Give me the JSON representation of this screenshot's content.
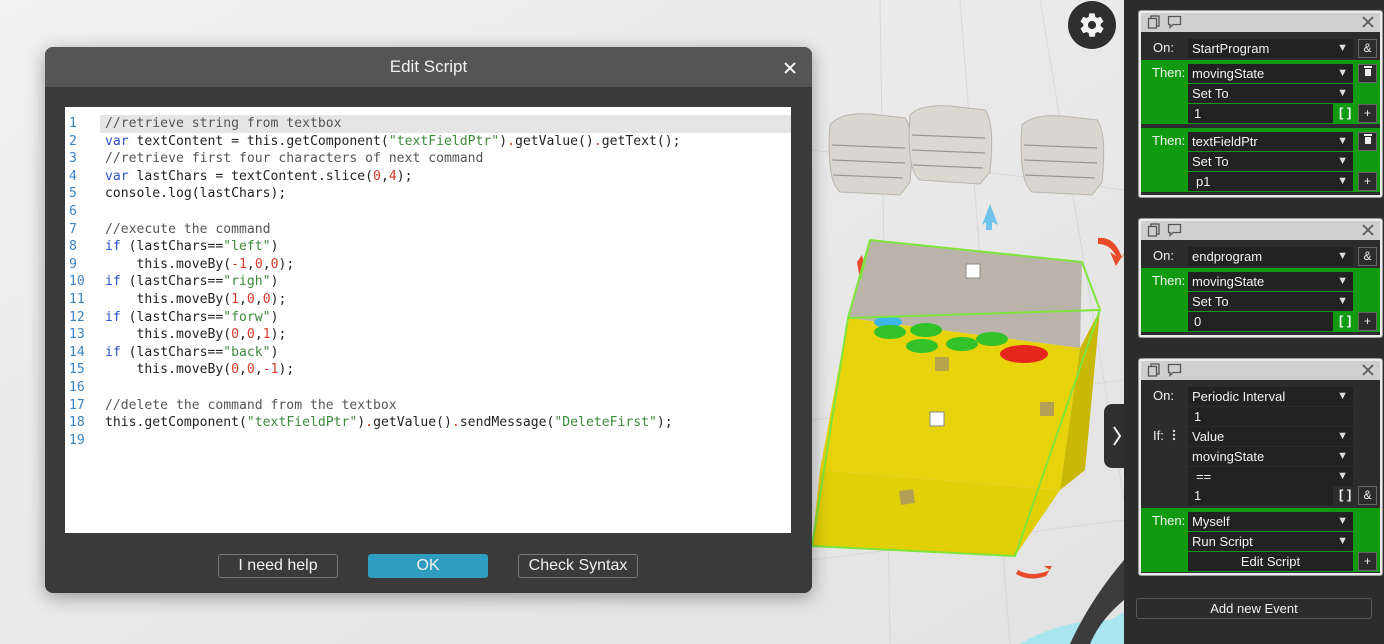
{
  "dialog": {
    "title": "Edit Script",
    "close_icon": "close-icon",
    "code_lines": [
      {
        "n": "1",
        "parts": [
          [
            "c",
            "//retrieve string from textbox"
          ]
        ],
        "active": true
      },
      {
        "n": "2",
        "parts": [
          [
            "k",
            "var"
          ],
          [
            "",
            " textContent = this.getComponent("
          ],
          [
            "s",
            "\"textFieldPtr\""
          ],
          [
            "",
            ")"
          ],
          [
            "p",
            "."
          ],
          [
            "",
            "getValue()"
          ],
          [
            "p",
            "."
          ],
          [
            "",
            "getText();"
          ]
        ]
      },
      {
        "n": "3",
        "parts": [
          [
            "c",
            "//retrieve first four characters of next command"
          ]
        ]
      },
      {
        "n": "4",
        "parts": [
          [
            "k",
            "var"
          ],
          [
            "",
            " lastChars = textContent.slice("
          ],
          [
            "n",
            "0"
          ],
          [
            "",
            ","
          ],
          [
            "n",
            "4"
          ],
          [
            "",
            ");"
          ]
        ]
      },
      {
        "n": "5",
        "parts": [
          [
            "",
            "console.log(lastChars);"
          ]
        ]
      },
      {
        "n": "6",
        "parts": []
      },
      {
        "n": "7",
        "parts": [
          [
            "c",
            "//execute the command"
          ]
        ]
      },
      {
        "n": "8",
        "parts": [
          [
            "k",
            "if"
          ],
          [
            "",
            " (lastChars=="
          ],
          [
            "s",
            "\"left\""
          ],
          [
            "",
            ")"
          ]
        ]
      },
      {
        "n": "9",
        "parts": [
          [
            "",
            "    this.moveBy("
          ],
          [
            "n",
            "-1"
          ],
          [
            "",
            ","
          ],
          [
            "n",
            "0"
          ],
          [
            "",
            ","
          ],
          [
            "n",
            "0"
          ],
          [
            "",
            ");"
          ]
        ]
      },
      {
        "n": "10",
        "parts": [
          [
            "k",
            "if"
          ],
          [
            "",
            " (lastChars=="
          ],
          [
            "s",
            "\"righ\""
          ],
          [
            "",
            ")"
          ]
        ]
      },
      {
        "n": "11",
        "parts": [
          [
            "",
            "    this.moveBy("
          ],
          [
            "n",
            "1"
          ],
          [
            "",
            ","
          ],
          [
            "n",
            "0"
          ],
          [
            "",
            ","
          ],
          [
            "n",
            "0"
          ],
          [
            "",
            ");"
          ]
        ]
      },
      {
        "n": "12",
        "parts": [
          [
            "k",
            "if"
          ],
          [
            "",
            " (lastChars=="
          ],
          [
            "s",
            "\"forw\""
          ],
          [
            "",
            ")"
          ]
        ]
      },
      {
        "n": "13",
        "parts": [
          [
            "",
            "    this.moveBy("
          ],
          [
            "n",
            "0"
          ],
          [
            "",
            ","
          ],
          [
            "n",
            "0"
          ],
          [
            "",
            ","
          ],
          [
            "n",
            "1"
          ],
          [
            "",
            ");"
          ]
        ]
      },
      {
        "n": "14",
        "parts": [
          [
            "k",
            "if"
          ],
          [
            "",
            " (lastChars=="
          ],
          [
            "s",
            "\"back\""
          ],
          [
            "",
            ")"
          ]
        ]
      },
      {
        "n": "15",
        "parts": [
          [
            "",
            "    this.moveBy("
          ],
          [
            "n",
            "0"
          ],
          [
            "",
            ","
          ],
          [
            "n",
            "0"
          ],
          [
            "",
            ","
          ],
          [
            "n",
            "-1"
          ],
          [
            "",
            ");"
          ]
        ]
      },
      {
        "n": "16",
        "parts": []
      },
      {
        "n": "17",
        "parts": [
          [
            "c",
            "//delete the command from the textbox"
          ]
        ]
      },
      {
        "n": "18",
        "parts": [
          [
            "",
            "this.getComponent("
          ],
          [
            "s",
            "\"textFieldPtr\""
          ],
          [
            "",
            ")"
          ],
          [
            "p",
            "."
          ],
          [
            "",
            "getValue()"
          ],
          [
            "p",
            "."
          ],
          [
            "",
            "sendMessage("
          ],
          [
            "s",
            "\"DeleteFirst\""
          ],
          [
            "",
            ");"
          ]
        ]
      },
      {
        "n": "19",
        "parts": []
      }
    ],
    "buttons": {
      "help": "I need help",
      "ok": "OK",
      "check": "Check Syntax"
    }
  },
  "panel": {
    "events": [
      {
        "on_label": "On:",
        "trigger": "StartProgram",
        "and_btn": "&",
        "actions": [
          {
            "label": "Then:",
            "target": "movingState",
            "op": "Set To",
            "value": "1",
            "array_btn": "[ ]",
            "add_btn": "+"
          },
          {
            "label": "Then:",
            "target": "textFieldPtr",
            "op": "Set To",
            "value": "p1",
            "add_btn": "+"
          }
        ]
      },
      {
        "on_label": "On:",
        "trigger": "endprogram",
        "and_btn": "&",
        "actions": [
          {
            "label": "Then:",
            "target": "movingState",
            "op": "Set To",
            "value": "0",
            "array_btn": "[ ]",
            "add_btn": "+"
          }
        ]
      },
      {
        "on_label": "On:",
        "trigger": "Periodic Interval",
        "interval": "1",
        "if_label": "If:",
        "if_type": "Value",
        "if_var": "movingState",
        "if_op": "==",
        "if_value": "1",
        "array_btn": "[ ]",
        "and_btn": "&",
        "actions": [
          {
            "label": "Then:",
            "target": "Myself",
            "op": "Run Script",
            "edit_label": "Edit Script",
            "add_btn": "+"
          }
        ]
      }
    ],
    "add_event": "Add new Event",
    "dropdown_arrow": "▼"
  },
  "icons": {
    "settings": "gear-icon",
    "toggle": "chevron-right-icon",
    "copy": "copy-icon",
    "comment": "comment-icon",
    "delete": "trash-icon"
  }
}
